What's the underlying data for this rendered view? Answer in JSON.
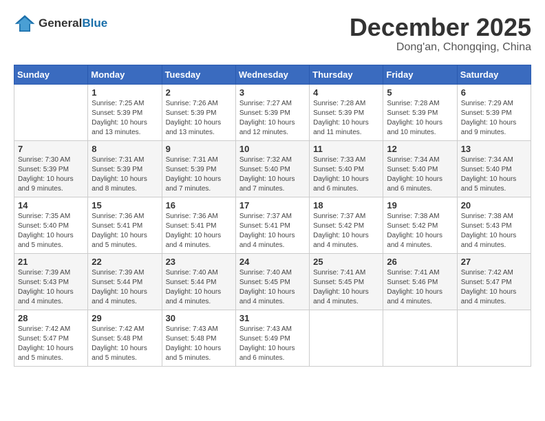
{
  "logo": {
    "general": "General",
    "blue": "Blue"
  },
  "header": {
    "month": "December 2025",
    "location": "Dong'an, Chongqing, China"
  },
  "weekdays": [
    "Sunday",
    "Monday",
    "Tuesday",
    "Wednesday",
    "Thursday",
    "Friday",
    "Saturday"
  ],
  "weeks": [
    [
      {
        "day": "",
        "info": ""
      },
      {
        "day": "1",
        "info": "Sunrise: 7:25 AM\nSunset: 5:39 PM\nDaylight: 10 hours\nand 13 minutes."
      },
      {
        "day": "2",
        "info": "Sunrise: 7:26 AM\nSunset: 5:39 PM\nDaylight: 10 hours\nand 13 minutes."
      },
      {
        "day": "3",
        "info": "Sunrise: 7:27 AM\nSunset: 5:39 PM\nDaylight: 10 hours\nand 12 minutes."
      },
      {
        "day": "4",
        "info": "Sunrise: 7:28 AM\nSunset: 5:39 PM\nDaylight: 10 hours\nand 11 minutes."
      },
      {
        "day": "5",
        "info": "Sunrise: 7:28 AM\nSunset: 5:39 PM\nDaylight: 10 hours\nand 10 minutes."
      },
      {
        "day": "6",
        "info": "Sunrise: 7:29 AM\nSunset: 5:39 PM\nDaylight: 10 hours\nand 9 minutes."
      }
    ],
    [
      {
        "day": "7",
        "info": "Sunrise: 7:30 AM\nSunset: 5:39 PM\nDaylight: 10 hours\nand 9 minutes."
      },
      {
        "day": "8",
        "info": "Sunrise: 7:31 AM\nSunset: 5:39 PM\nDaylight: 10 hours\nand 8 minutes."
      },
      {
        "day": "9",
        "info": "Sunrise: 7:31 AM\nSunset: 5:39 PM\nDaylight: 10 hours\nand 7 minutes."
      },
      {
        "day": "10",
        "info": "Sunrise: 7:32 AM\nSunset: 5:40 PM\nDaylight: 10 hours\nand 7 minutes."
      },
      {
        "day": "11",
        "info": "Sunrise: 7:33 AM\nSunset: 5:40 PM\nDaylight: 10 hours\nand 6 minutes."
      },
      {
        "day": "12",
        "info": "Sunrise: 7:34 AM\nSunset: 5:40 PM\nDaylight: 10 hours\nand 6 minutes."
      },
      {
        "day": "13",
        "info": "Sunrise: 7:34 AM\nSunset: 5:40 PM\nDaylight: 10 hours\nand 5 minutes."
      }
    ],
    [
      {
        "day": "14",
        "info": "Sunrise: 7:35 AM\nSunset: 5:40 PM\nDaylight: 10 hours\nand 5 minutes."
      },
      {
        "day": "15",
        "info": "Sunrise: 7:36 AM\nSunset: 5:41 PM\nDaylight: 10 hours\nand 5 minutes."
      },
      {
        "day": "16",
        "info": "Sunrise: 7:36 AM\nSunset: 5:41 PM\nDaylight: 10 hours\nand 4 minutes."
      },
      {
        "day": "17",
        "info": "Sunrise: 7:37 AM\nSunset: 5:41 PM\nDaylight: 10 hours\nand 4 minutes."
      },
      {
        "day": "18",
        "info": "Sunrise: 7:37 AM\nSunset: 5:42 PM\nDaylight: 10 hours\nand 4 minutes."
      },
      {
        "day": "19",
        "info": "Sunrise: 7:38 AM\nSunset: 5:42 PM\nDaylight: 10 hours\nand 4 minutes."
      },
      {
        "day": "20",
        "info": "Sunrise: 7:38 AM\nSunset: 5:43 PM\nDaylight: 10 hours\nand 4 minutes."
      }
    ],
    [
      {
        "day": "21",
        "info": "Sunrise: 7:39 AM\nSunset: 5:43 PM\nDaylight: 10 hours\nand 4 minutes."
      },
      {
        "day": "22",
        "info": "Sunrise: 7:39 AM\nSunset: 5:44 PM\nDaylight: 10 hours\nand 4 minutes."
      },
      {
        "day": "23",
        "info": "Sunrise: 7:40 AM\nSunset: 5:44 PM\nDaylight: 10 hours\nand 4 minutes."
      },
      {
        "day": "24",
        "info": "Sunrise: 7:40 AM\nSunset: 5:45 PM\nDaylight: 10 hours\nand 4 minutes."
      },
      {
        "day": "25",
        "info": "Sunrise: 7:41 AM\nSunset: 5:45 PM\nDaylight: 10 hours\nand 4 minutes."
      },
      {
        "day": "26",
        "info": "Sunrise: 7:41 AM\nSunset: 5:46 PM\nDaylight: 10 hours\nand 4 minutes."
      },
      {
        "day": "27",
        "info": "Sunrise: 7:42 AM\nSunset: 5:47 PM\nDaylight: 10 hours\nand 4 minutes."
      }
    ],
    [
      {
        "day": "28",
        "info": "Sunrise: 7:42 AM\nSunset: 5:47 PM\nDaylight: 10 hours\nand 5 minutes."
      },
      {
        "day": "29",
        "info": "Sunrise: 7:42 AM\nSunset: 5:48 PM\nDaylight: 10 hours\nand 5 minutes."
      },
      {
        "day": "30",
        "info": "Sunrise: 7:43 AM\nSunset: 5:48 PM\nDaylight: 10 hours\nand 5 minutes."
      },
      {
        "day": "31",
        "info": "Sunrise: 7:43 AM\nSunset: 5:49 PM\nDaylight: 10 hours\nand 6 minutes."
      },
      {
        "day": "",
        "info": ""
      },
      {
        "day": "",
        "info": ""
      },
      {
        "day": "",
        "info": ""
      }
    ]
  ]
}
